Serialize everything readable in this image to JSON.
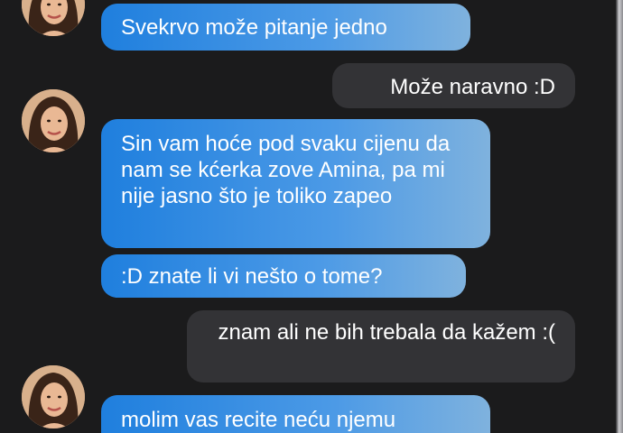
{
  "conversation": {
    "messages": [
      {
        "direction": "incoming",
        "text": "Svekrvo može pitanje jedno"
      },
      {
        "direction": "outgoing",
        "text": "Može naravno :D"
      },
      {
        "direction": "incoming",
        "text": "Sin vam hoće pod svaku cijenu da nam se kćerka zove Amina, pa mi nije jasno što je toliko zapeo"
      },
      {
        "direction": "incoming",
        "text": ":D znate li vi nešto o tome?"
      },
      {
        "direction": "outgoing",
        "text": "znam ali ne bih trebala da kažem :("
      },
      {
        "direction": "incoming",
        "text": "molim vas recite neću njemu"
      }
    ]
  },
  "colors": {
    "background": "#1b1b1c",
    "incoming_bubble_start": "#1f7fde",
    "incoming_bubble_end": "#7fb2de",
    "outgoing_bubble": "#333336",
    "text": "#ffffff"
  },
  "icons": {
    "avatar": "contact-avatar-photo"
  }
}
